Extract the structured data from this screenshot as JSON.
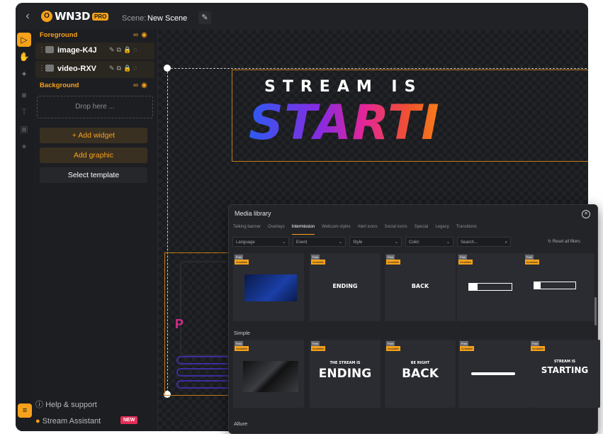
{
  "topbar": {
    "back_icon": "chevron-left-icon",
    "logo_text": "WN3D",
    "logo_mark": "O",
    "logo_badge": "PRO",
    "scene_label": "Scene:",
    "scene_name": "New Scene",
    "edit_icon": "pencil-icon"
  },
  "toolstrip": {
    "tools": [
      "cursor-icon",
      "hand-icon",
      "plus-icon",
      "layers-icon",
      "image-icon",
      "text-icon",
      "grid-icon"
    ],
    "layers_tab_icon": "layers-icon"
  },
  "panel": {
    "foreground_label": "Foreground",
    "background_label": "Background",
    "layers": [
      {
        "name": "image-K4J"
      },
      {
        "name": "video-RXV"
      }
    ],
    "drop_here": "Drop here ...",
    "add_widget": "+ Add widget",
    "add_graphic": "Add graphic",
    "select_template": "Select template",
    "help": "Help & support",
    "assistant": "Stream Assistant",
    "new_badge": "NEW"
  },
  "canvas": {
    "title_line1": "STREAM IS",
    "title_line2": "STARTI",
    "lower_letter": "P"
  },
  "media_library": {
    "title": "Media library",
    "tabs": [
      "Talking banner",
      "Overlays",
      "Intermission",
      "Webcam styles",
      "Alert icons",
      "Social icons",
      "Special",
      "Legacy",
      "Transitions"
    ],
    "active_tab": "Intermission",
    "filters": [
      "Language",
      "Event",
      "Style",
      "Color"
    ],
    "search_placeholder": "Search...",
    "reset": "Reset all filters",
    "section_simple": "Simple",
    "section_allure": "Allure",
    "badge_free": "Free",
    "badge_available": "Available",
    "row1_captions": [
      "",
      "ENDING",
      "BACK",
      "",
      ""
    ],
    "row2_captions": [
      "",
      "ENDING",
      "BACK",
      "",
      "STARTING"
    ],
    "row2_sub": [
      "",
      "THE STREAM IS",
      "BE RIGHT",
      "",
      "STREAM IS"
    ]
  }
}
